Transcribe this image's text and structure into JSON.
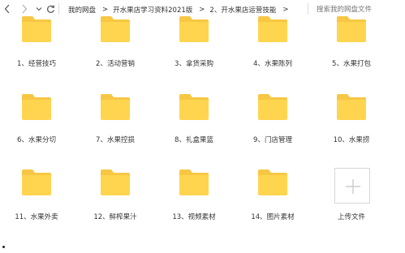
{
  "toolbar": {
    "breadcrumb": [
      "我的网盘",
      "开水果店学习资料2021版",
      "2、开水果店运营技能"
    ],
    "breadcrumb_separator": ">",
    "search_placeholder": "搜索我的网盘文件"
  },
  "icons": {
    "back": "chevron-left-icon",
    "forward": "chevron-right-icon",
    "history": "chevron-down-icon",
    "refresh": "refresh-icon",
    "folder": "folder-icon",
    "upload": "plus-icon"
  },
  "colors": {
    "folder_body": "#ffd54f",
    "folder_tab": "#f7c744",
    "text": "#333333",
    "placeholder": "#b3b3b3"
  },
  "folders": [
    {
      "name": "1、经营技巧"
    },
    {
      "name": "2、活动营销"
    },
    {
      "name": "3、拿货采购"
    },
    {
      "name": "4、水果陈列"
    },
    {
      "name": "5、水果打包"
    },
    {
      "name": "6、水果分切"
    },
    {
      "name": "7、水果控损"
    },
    {
      "name": "8、礼盒果篮"
    },
    {
      "name": "9、门店管理"
    },
    {
      "name": "10、水果捞"
    },
    {
      "name": "11、水果外卖"
    },
    {
      "name": "12、鲜榨果汁"
    },
    {
      "name": "13、视频素材"
    },
    {
      "name": "14、图片素材"
    }
  ],
  "upload": {
    "label": "上传文件"
  }
}
